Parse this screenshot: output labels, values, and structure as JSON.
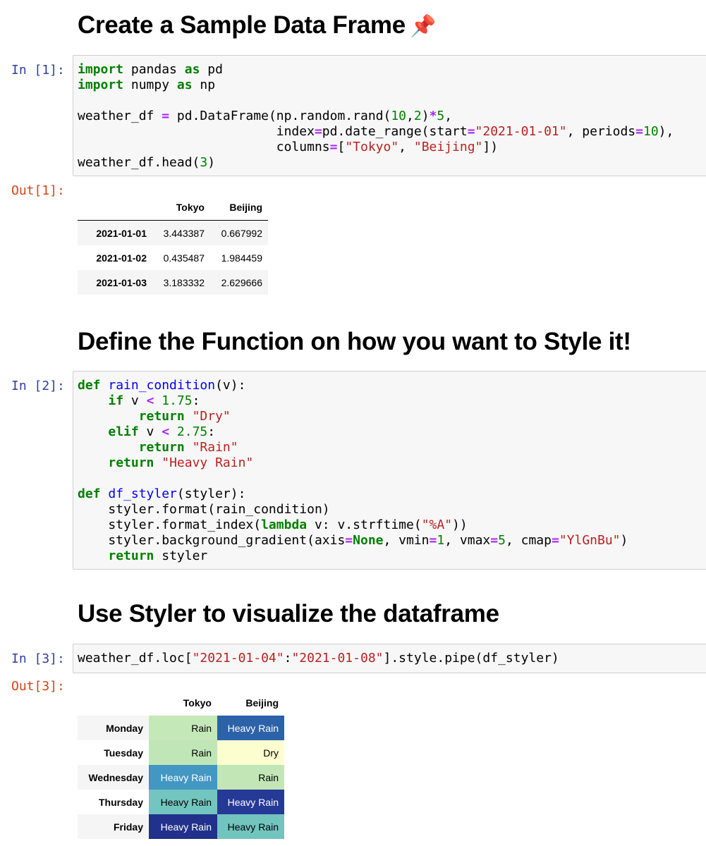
{
  "headings": {
    "sample": "Create a Sample Data Frame",
    "sample_icon": "📌",
    "function": "Define the Function on how you want to Style it!",
    "styler": "Use Styler to visualize the dataframe"
  },
  "prompts": {
    "in1": "In [1]:",
    "out1": "Out[1]:",
    "in2": "In [2]:",
    "in3": "In [3]:",
    "out3": "Out[3]:"
  },
  "cell1": {
    "l1": {
      "a": "import",
      "b": " pandas ",
      "c": "as",
      "d": " pd"
    },
    "l2": {
      "a": "import",
      "b": " numpy ",
      "c": "as",
      "d": " np"
    },
    "l4": {
      "a": "weather_df ",
      "b": "=",
      "c": " pd.DataFrame(np.random.rand(",
      "d": "10",
      "e": ",",
      "f": "2",
      "g": ")",
      "h": "*",
      "i": "5",
      "j": ","
    },
    "l5": {
      "a": "                          index",
      "b": "=",
      "c": "pd.date_range(start",
      "d": "=",
      "e": "\"2021-01-01\"",
      "f": ", periods",
      "g": "=",
      "h": "10",
      "i": "),"
    },
    "l6": {
      "a": "                          columns",
      "b": "=",
      "c": "[",
      "d": "\"Tokyo\"",
      "e": ", ",
      "f": "\"Beijing\"",
      "g": "])"
    },
    "l7": {
      "a": "weather_df.head(",
      "b": "3",
      "c": ")"
    }
  },
  "cell2": {
    "l1": {
      "a": "def",
      "b": " ",
      "c": "rain_condition",
      "d": "(v):"
    },
    "l2": {
      "a": "    ",
      "b": "if",
      "c": " v ",
      "d": "<",
      "e": " ",
      "f": "1.75",
      "g": ":"
    },
    "l3": {
      "a": "        ",
      "b": "return",
      "c": " ",
      "d": "\"Dry\""
    },
    "l4": {
      "a": "    ",
      "b": "elif",
      "c": " v ",
      "d": "<",
      "e": " ",
      "f": "2.75",
      "g": ":"
    },
    "l5": {
      "a": "        ",
      "b": "return",
      "c": " ",
      "d": "\"Rain\""
    },
    "l6": {
      "a": "    ",
      "b": "return",
      "c": " ",
      "d": "\"Heavy Rain\""
    },
    "l8": {
      "a": "def",
      "b": " ",
      "c": "df_styler",
      "d": "(styler):"
    },
    "l9": {
      "a": "    styler.format(rain_condition)"
    },
    "l10": {
      "a": "    styler.format_index(",
      "b": "lambda",
      "c": " v: v.strftime(",
      "d": "\"%A\"",
      "e": "))"
    },
    "l11": {
      "a": "    styler.background_gradient(axis",
      "b": "=",
      "c": "None",
      "d": ", vmin",
      "e": "=",
      "f": "1",
      "g": ", vmax",
      "h": "=",
      "i": "5",
      "j": ", cmap",
      "k": "=",
      "l": "\"YlGnBu\"",
      "m": ")"
    },
    "l12": {
      "a": "    ",
      "b": "return",
      "c": " styler"
    }
  },
  "cell3": {
    "l1": {
      "a": "weather_df.loc[",
      "b": "\"2021-01-04\"",
      "c": ":",
      "d": "\"2021-01-08\"",
      "e": "].style.pipe(df_styler)"
    }
  },
  "table1": {
    "columns": [
      "Tokyo",
      "Beijing"
    ],
    "rows": [
      {
        "index": "2021-01-01",
        "values": [
          "3.443387",
          "0.667992"
        ]
      },
      {
        "index": "2021-01-02",
        "values": [
          "0.435487",
          "1.984459"
        ]
      },
      {
        "index": "2021-01-03",
        "values": [
          "3.183332",
          "2.629666"
        ]
      }
    ]
  },
  "table2": {
    "columns": [
      "Tokyo",
      "Beijing"
    ],
    "rows": [
      {
        "index": "Monday",
        "values": [
          "Rain",
          "Heavy Rain"
        ],
        "bg": [
          "#c5e8b8",
          "#2c62a8"
        ],
        "fg": [
          "#000000",
          "#ffffff"
        ]
      },
      {
        "index": "Tuesday",
        "values": [
          "Rain",
          "Dry"
        ],
        "bg": [
          "#c0e6b7",
          "#fcfed0"
        ],
        "fg": [
          "#000000",
          "#000000"
        ]
      },
      {
        "index": "Wednesday",
        "values": [
          "Heavy Rain",
          "Rain"
        ],
        "bg": [
          "#4297c3",
          "#c2e6b6"
        ],
        "fg": [
          "#ffffff",
          "#000000"
        ]
      },
      {
        "index": "Thursday",
        "values": [
          "Heavy Rain",
          "Heavy Rain"
        ],
        "bg": [
          "#73c5c0",
          "#253997"
        ],
        "fg": [
          "#000000",
          "#ffffff"
        ]
      },
      {
        "index": "Friday",
        "values": [
          "Heavy Rain",
          "Heavy Rain"
        ],
        "bg": [
          "#22318c",
          "#72c4bf"
        ],
        "fg": [
          "#ffffff",
          "#000000"
        ]
      }
    ]
  }
}
